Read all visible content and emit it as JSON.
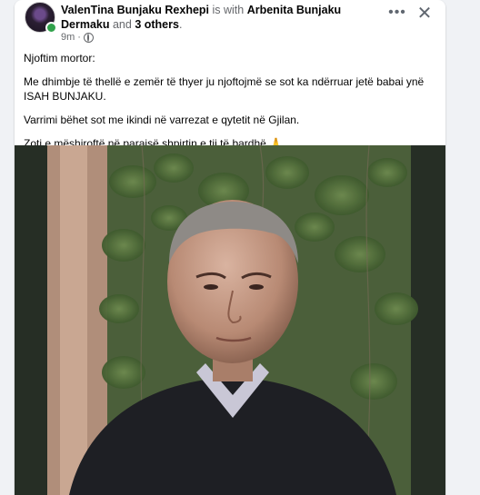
{
  "post": {
    "author": "ValenTina Bunjaku Rexhepi",
    "with_text": " is with ",
    "tagged": "Arbenita Bunjaku Dermaku",
    "and_text": " and ",
    "others": "3 others",
    "period": ".",
    "time": "9m",
    "dot": "·",
    "privacy_icon": "globe-icon",
    "more_icon": "more-horizontal-icon",
    "close_icon": "close-icon",
    "more_glyph": "•••",
    "close_glyph": "✕",
    "paragraphs": [
      "Njoftim mortor:",
      "Me dhimbje të thellë e zemër të thyer ju njoftojmë se sot ka ndërruar jetë babai ynë ISAH BUNJAKU.",
      "Varrimi bëhet sot me ikindi në varrezat e qytetit në Gjilan.",
      "Zoti e mëshiroftë në parajsë shpirtin e tij të bardhë 🙏"
    ]
  }
}
